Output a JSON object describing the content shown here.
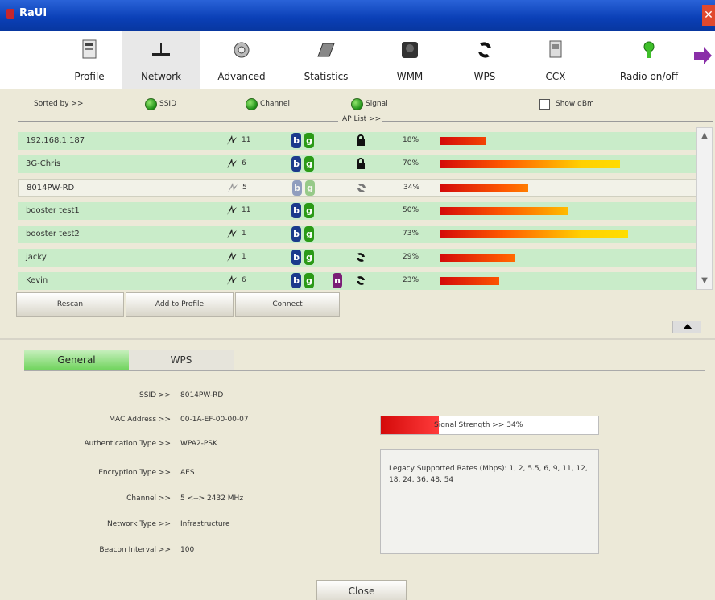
{
  "window": {
    "title": "RaUI",
    "close_glyph": "✕"
  },
  "toolbar": {
    "items": [
      {
        "label": "Profile",
        "icon": "profile-icon"
      },
      {
        "label": "Network",
        "icon": "network-icon",
        "active": true
      },
      {
        "label": "Advanced",
        "icon": "advanced-icon"
      },
      {
        "label": "Statistics",
        "icon": "statistics-icon"
      },
      {
        "label": "WMM",
        "icon": "wmm-icon"
      },
      {
        "label": "WPS",
        "icon": "wps-icon"
      },
      {
        "label": "CCX",
        "icon": "ccx-icon"
      },
      {
        "label": "Radio on/off",
        "icon": "radio-icon"
      }
    ],
    "more_icon": "arrow-right-icon"
  },
  "sortbar": {
    "sorted_by": "Sorted by >>",
    "ssid": "SSID",
    "channel": "Channel",
    "signal": "Signal",
    "show_dbm": "Show dBm"
  },
  "aplist": {
    "title": "AP List >>",
    "rows": [
      {
        "ssid": "192.168.1.187",
        "channel": "11",
        "b": true,
        "g": true,
        "n": false,
        "icon": "lock",
        "signal": "18%",
        "signal_value": 18
      },
      {
        "ssid": "3G-Chris",
        "channel": "6",
        "b": true,
        "g": true,
        "n": false,
        "icon": "lock",
        "signal": "70%",
        "signal_value": 70
      },
      {
        "ssid": "8014PW-RD",
        "channel": "5",
        "b": true,
        "g": true,
        "n": false,
        "icon": "wps",
        "signal": "34%",
        "signal_value": 34,
        "selected": true
      },
      {
        "ssid": "booster test1",
        "channel": "11",
        "b": true,
        "g": true,
        "n": false,
        "icon": "",
        "signal": "50%",
        "signal_value": 50
      },
      {
        "ssid": "booster test2",
        "channel": "1",
        "b": true,
        "g": true,
        "n": false,
        "icon": "",
        "signal": "73%",
        "signal_value": 73
      },
      {
        "ssid": "jacky",
        "channel": "1",
        "b": true,
        "g": true,
        "n": false,
        "icon": "wps",
        "signal": "29%",
        "signal_value": 29
      },
      {
        "ssid": "Kevin",
        "channel": "6",
        "b": true,
        "g": true,
        "n": true,
        "icon": "wps",
        "signal": "23%",
        "signal_value": 23
      }
    ]
  },
  "buttons": {
    "rescan": "Rescan",
    "add_to_profile": "Add to Profile",
    "connect": "Connect"
  },
  "tabs": {
    "general": "General",
    "wps": "WPS"
  },
  "details": {
    "ssid_label": "SSID >>",
    "ssid": "8014PW-RD",
    "mac_label": "MAC Address >>",
    "mac": "00-1A-EF-00-00-07",
    "auth_label": "Authentication Type >>",
    "auth": "WPA2-PSK",
    "enc_label": "Encryption Type >>",
    "enc": "AES",
    "channel_label": "Channel >>",
    "channel": "5 <--> 2432 MHz",
    "nettype_label": "Network Type >>",
    "nettype": "Infrastructure",
    "beacon_label": "Beacon Interval >>",
    "beacon": "100"
  },
  "signal": {
    "text": "Signal Strength >> 34%",
    "value": 34
  },
  "rates": {
    "text": "Legacy Supported Rates (Mbps): 1, 2, 5.5, 6, 9, 11, 12, 18, 24, 36, 48, 54"
  },
  "close": "Close"
}
